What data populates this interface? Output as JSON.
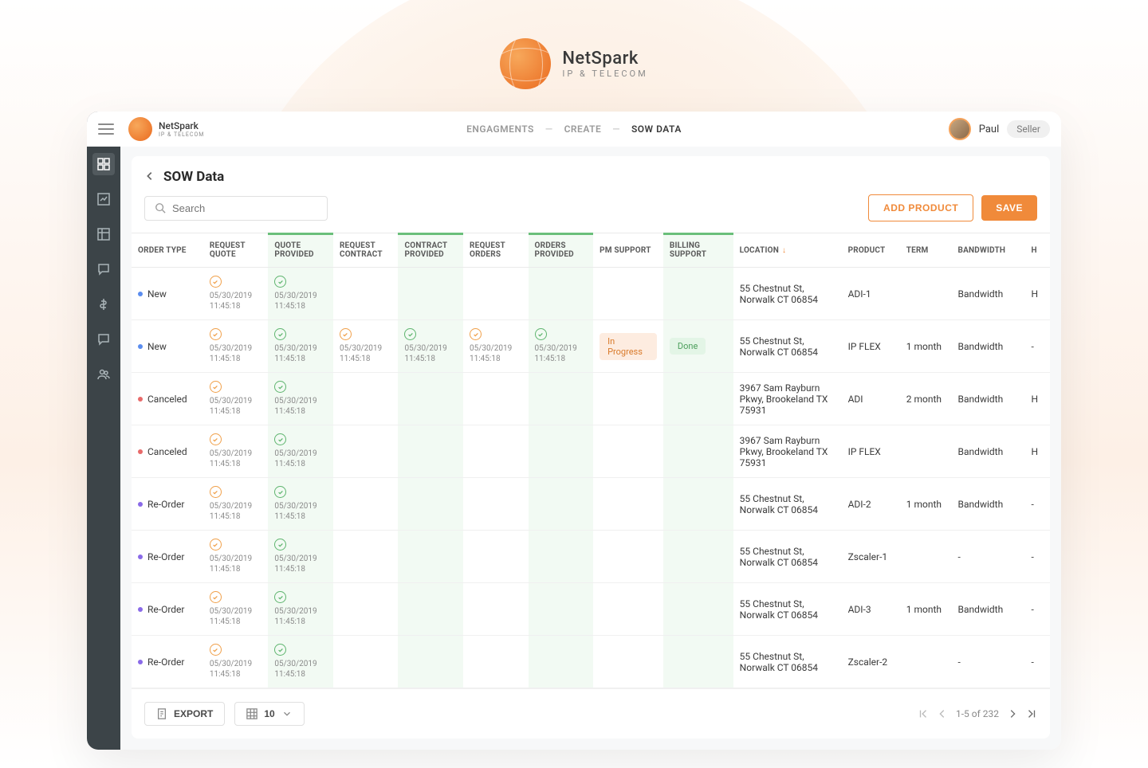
{
  "brand": {
    "name": "NetSpark",
    "sub": "IP & TELECOM"
  },
  "breadcrumb": {
    "engagements": "ENGAGMENTS",
    "create": "CREATE",
    "sow": "SOW DATA"
  },
  "user": {
    "name": "Paul",
    "role": "Seller"
  },
  "page": {
    "title": "SOW Data"
  },
  "search": {
    "placeholder": "Search"
  },
  "buttons": {
    "add_product": "ADD PRODUCT",
    "save": "SAVE",
    "export": "EXPORT"
  },
  "columns": {
    "order_type": "ORDER TYPE",
    "request_quote": "REQUEST QUOTE",
    "quote_provided": "QUOTE PROVIDED",
    "request_contract": "REQUEST CONTRACT",
    "contract_provided": "CONTRACT PROVIDED",
    "request_orders": "REQUEST ORDERS",
    "orders_provided": "ORDERS PROVIDED",
    "pm_support": "PM SUPPORT",
    "billing_support": "BILLING SUPPORT",
    "location": "LOCATION",
    "product": "PRODUCT",
    "term": "TERM",
    "bandwidth": "BANDWIDTH",
    "h": "H"
  },
  "status": {
    "in_progress": "In Progress",
    "done": "Done"
  },
  "timestamp": "05/30/2019 11:45:18",
  "rows": [
    {
      "type": "New",
      "dot": "blue",
      "rq": "o",
      "qp": "g",
      "rc": "",
      "cp": "",
      "ro": "",
      "op": "",
      "pm": "",
      "bill": "",
      "loc": "55 Chestnut St, Norwalk CT 06854",
      "prod": "ADI-1",
      "term": "",
      "bw": "Bandwidth",
      "h": "H"
    },
    {
      "type": "New",
      "dot": "blue",
      "rq": "o",
      "qp": "g",
      "rc": "o",
      "cp": "g",
      "ro": "o",
      "op": "g",
      "pm": "progress",
      "bill": "done",
      "loc": "55 Chestnut St, Norwalk CT 06854",
      "prod": "IP FLEX",
      "term": "1 month",
      "bw": "Bandwidth",
      "h": "-"
    },
    {
      "type": "Canceled",
      "dot": "red",
      "rq": "o",
      "qp": "g",
      "rc": "",
      "cp": "",
      "ro": "",
      "op": "",
      "pm": "",
      "bill": "",
      "loc": "3967 Sam Rayburn Pkwy, Brookeland TX 75931",
      "prod": "ADI",
      "term": "2 month",
      "bw": "Bandwidth",
      "h": "H"
    },
    {
      "type": "Canceled",
      "dot": "red",
      "rq": "o",
      "qp": "g",
      "rc": "",
      "cp": "",
      "ro": "",
      "op": "",
      "pm": "",
      "bill": "",
      "loc": "3967 Sam Rayburn Pkwy, Brookeland TX 75931",
      "prod": "IP FLEX",
      "term": "",
      "bw": "Bandwidth",
      "h": "H"
    },
    {
      "type": "Re-Order",
      "dot": "purple",
      "rq": "o",
      "qp": "g",
      "rc": "",
      "cp": "",
      "ro": "",
      "op": "",
      "pm": "",
      "bill": "",
      "loc": "55 Chestnut St, Norwalk CT 06854",
      "prod": "ADI-2",
      "term": "1 month",
      "bw": "Bandwidth",
      "h": "-"
    },
    {
      "type": "Re-Order",
      "dot": "purple",
      "rq": "o",
      "qp": "g",
      "rc": "",
      "cp": "",
      "ro": "",
      "op": "",
      "pm": "",
      "bill": "",
      "loc": "55 Chestnut St, Norwalk CT 06854",
      "prod": "Zscaler-1",
      "term": "",
      "bw": "-",
      "h": "-"
    },
    {
      "type": "Re-Order",
      "dot": "purple",
      "rq": "o",
      "qp": "g",
      "rc": "",
      "cp": "",
      "ro": "",
      "op": "",
      "pm": "",
      "bill": "",
      "loc": "55 Chestnut St, Norwalk CT 06854",
      "prod": "ADI-3",
      "term": "1 month",
      "bw": "Bandwidth",
      "h": "-"
    },
    {
      "type": "Re-Order",
      "dot": "purple",
      "rq": "o",
      "qp": "g",
      "rc": "",
      "cp": "",
      "ro": "",
      "op": "",
      "pm": "",
      "bill": "",
      "loc": "55 Chestnut St, Norwalk CT 06854",
      "prod": "Zscaler-2",
      "term": "",
      "bw": "-",
      "h": "-"
    }
  ],
  "footer": {
    "page_size": "10",
    "range": "1-5 of 232"
  },
  "colors": {
    "accent": "#f08a3a",
    "green": "#5fb56f"
  }
}
